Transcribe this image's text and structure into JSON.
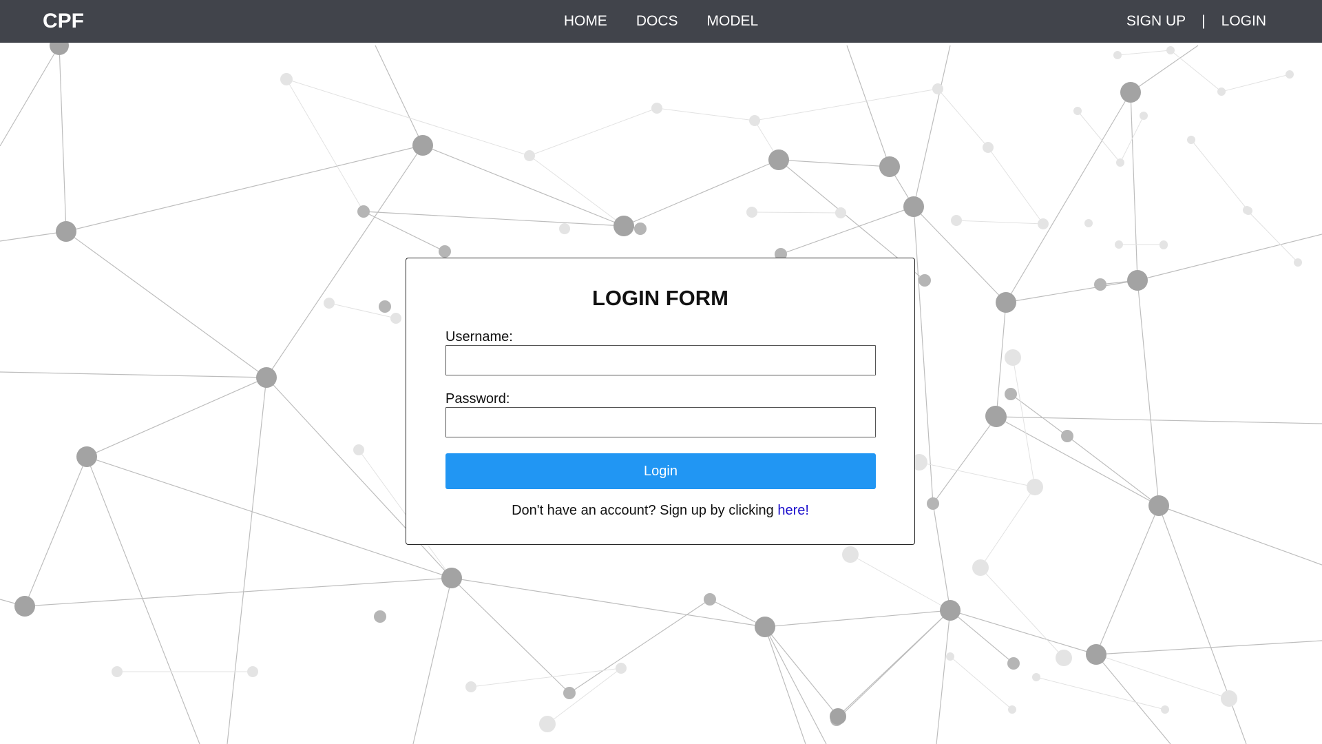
{
  "navbar": {
    "brand": "CPF",
    "links": [
      "HOME",
      "DOCS",
      "MODEL"
    ],
    "signup_label": "SIGN UP",
    "separator": "|",
    "login_label": "LOGIN",
    "background_color": "#41444b"
  },
  "login_form": {
    "title": "LOGIN FORM",
    "username_label": "Username:",
    "username_value": "",
    "password_label": "Password:",
    "password_value": "",
    "submit_label": "Login",
    "submit_color": "#2196f3",
    "signup_prompt": "Don't have an account? Sign up by clicking ",
    "signup_link_text": "here!"
  },
  "background": {
    "icon": "network-graph-pattern"
  }
}
